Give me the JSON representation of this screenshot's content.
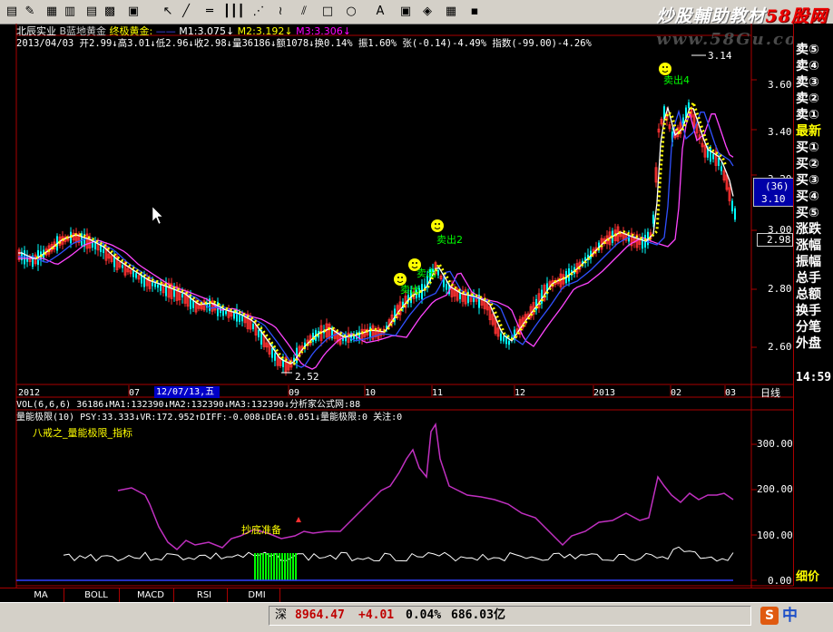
{
  "toolbar": {
    "icons": [
      "new-icon",
      "draw-icon",
      "grid-icon",
      "table-icon",
      "list-icon",
      "chart-icon",
      "window-icon",
      "cursor-icon",
      "line-icon",
      "hline-icon",
      "vlines-icon",
      "fan-icon",
      "wave-icon",
      "parallel-icon",
      "rect-icon",
      "ellipse-icon",
      "text-icon",
      "mark-icon",
      "eraser-icon",
      "palette-icon",
      "save-icon"
    ],
    "glyphs": [
      "▤",
      "✎",
      "▦",
      "▥",
      "▤",
      "▩",
      "▣",
      "↖",
      "╱",
      "═",
      "┃┃┃",
      "⋰",
      "≀",
      "⫽",
      "□",
      "○",
      "A",
      "▣",
      "◈",
      "▦",
      "▪"
    ]
  },
  "brand": {
    "text": "炒股輔助教材",
    "red": "58股网"
  },
  "site": "www.58Gu.com",
  "header": {
    "stock": "北辰实业",
    "indicator_name": "B蓝地黄金",
    "indicator2": "终极黄金:",
    "ma1": "M1:3.075↓",
    "ma2": "M2:3.192↓",
    "ma3": "M3:3.306↓",
    "infoline": "2013/04/03 开2.99↓高3.01↓低2.96↓收2.98↓量36186↓额1078↓换0.14% 振1.60% 张(-0.14)-4.49% 指数(-99.00)-4.26%"
  },
  "price_axis": [
    "3.60",
    "3.40",
    "3.20",
    "3.00",
    "2.80",
    "2.60"
  ],
  "price_top": "3.14",
  "price_low": "2.52",
  "cursor_box": {
    "line1": "(36)",
    "line2": "3.10"
  },
  "last_price_tag": "2.98",
  "signals": [
    {
      "label": "卖出4"
    },
    {
      "label": "卖出2"
    },
    {
      "label": "卖出"
    },
    {
      "label": "卖出"
    }
  ],
  "date_axis": {
    "labels": [
      "2012",
      "07",
      "12/07/13,五",
      "09",
      "10",
      "11",
      "12",
      "2013",
      "02",
      "03"
    ],
    "period": "日线"
  },
  "vol_line": "VOL(6,6,6) 36186↓MA1:132390↓MA2:132390↓MA3:132390↓分析家公式网:88",
  "sub": {
    "line": "量能极限(10) PSY:33.333↓VR:172.952↑DIFF:-0.008↓DEA:0.051↓量能极限:0 关注:0",
    "title": "八戒之_量能极限_指标",
    "axis": [
      "300.00",
      "200.00",
      "100.00",
      "0.00"
    ],
    "annotation": "抄底准备"
  },
  "side_labels": [
    "卖⑤",
    "卖④",
    "卖③",
    "卖②",
    "卖①",
    "最新",
    "买①",
    "买②",
    "买③",
    "买④",
    "买⑤",
    "涨跌",
    "涨幅",
    "振幅",
    "总手",
    "总额",
    "换手",
    "分笔",
    "外盘"
  ],
  "time": "14:59",
  "side_bottom": "细价",
  "tabs": [
    "MA",
    "BOLL",
    "MACD",
    "RSI",
    "DMI"
  ],
  "status": {
    "market": "深",
    "index": "8964.47",
    "change": "+4.01",
    "pct": "0.04%",
    "amount": "686.03亿",
    "brand_s": "S",
    "brand_zh": "中"
  },
  "colors": {
    "up": "#ff3232",
    "down": "#00ffff",
    "yellow": "#ffff00",
    "purple": "#ff00ff",
    "green": "#00ff00",
    "frame": "#aa0000"
  }
}
